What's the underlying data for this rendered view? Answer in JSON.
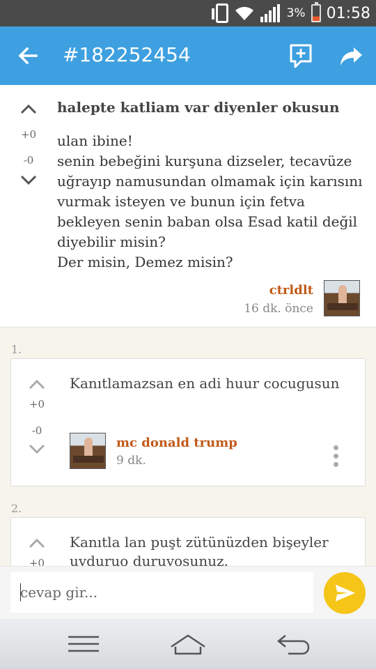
{
  "status_bar": {
    "battery_percent": "3%",
    "time": "01:58"
  },
  "app_bar": {
    "title": "#182252454",
    "back_icon": "arrow-left-icon",
    "add_comment_icon": "add-comment-icon",
    "share_icon": "share-icon",
    "color": "#3ea0e0"
  },
  "post": {
    "title": "halepte katliam var diyenler okusun",
    "body": "ulan ibine!\nsenin bebeğini kurşuna dizseler, tecavüze uğrayıp namusundan olmamak için karısını vurmak isteyen ve bunun için fetva bekleyen senin baban olsa Esad katil değil diyebilir misin?\nDer misin, Demez misin?",
    "upvotes": "+0",
    "downvotes": "-0",
    "author": "ctrldlt",
    "time": "16 dk. önce"
  },
  "comments": [
    {
      "number": "1.",
      "text": "Kanıtlamazsan en adi huur cocugusun",
      "upvotes": "+0",
      "downvotes": "-0",
      "author": "mc donald trump",
      "time": "9 dk."
    },
    {
      "number": "2.",
      "text": "Kanıtla lan puşt zütünüzden bişeyler uyduruo duruyosunuz.",
      "upvotes": "+0"
    }
  ],
  "reply": {
    "placeholder": "cevap gir..."
  },
  "colors": {
    "author": "#c05a18",
    "send_button": "#f5c518",
    "comments_bg": "#f7f4ec"
  }
}
